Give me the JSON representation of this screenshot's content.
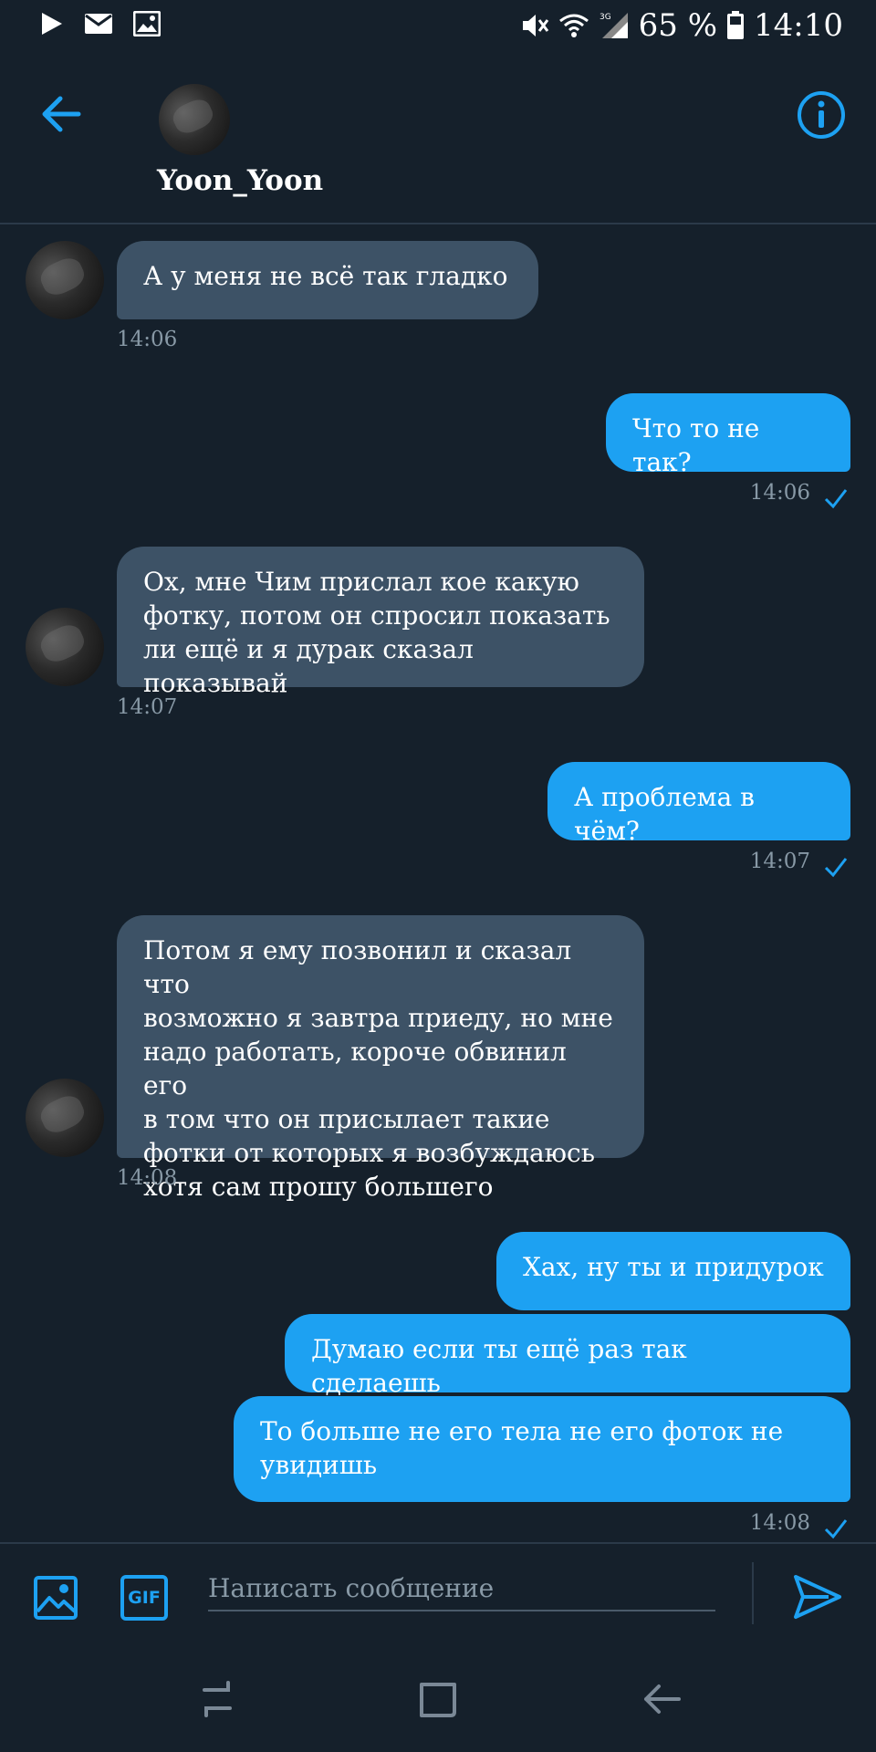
{
  "status_bar": {
    "icons": [
      "play-icon",
      "mail-icon",
      "image-icon",
      "mute-icon",
      "wifi-icon",
      "signal-icon",
      "battery-icon"
    ],
    "network": "3G",
    "battery": "65 %",
    "time": "14:10"
  },
  "header": {
    "username": "Yoon_Yoon"
  },
  "messages": [
    {
      "text": "А у меня не всё так гладко",
      "time": "14:06"
    },
    {
      "text": "Что то не так?",
      "time": "14:06"
    },
    {
      "text": "Ох, мне Чим прислал кое какую\nфотку, потом он спросил показать\nли ещё и я дурак сказал показывай",
      "time": "14:07"
    },
    {
      "text": "А проблема в чём?",
      "time": "14:07"
    },
    {
      "text": "Потом я ему позвонил и сказал что\nвозможно я завтра приеду, но мне\nнадо работать, короче обвинил его\nв том что он присылает такие\nфотки от которых я возбуждаюсь\nхотя сам прошу большего",
      "time": "14:08"
    },
    {
      "text": "Хах, ну ты и придурок"
    },
    {
      "text": "Думаю если ты ещё раз так сделаешь"
    },
    {
      "text": "То больше не его тела не его фоток не\nувидишь",
      "time": "14:08"
    }
  ],
  "compose": {
    "placeholder": "Написать сообщение",
    "gif_label": "GIF"
  },
  "colors": {
    "background": "#15202b",
    "incoming_bubble": "#3d5266",
    "outgoing_bubble": "#1da1f2",
    "accent": "#1da1f2",
    "timestamp": "#8899a6"
  }
}
